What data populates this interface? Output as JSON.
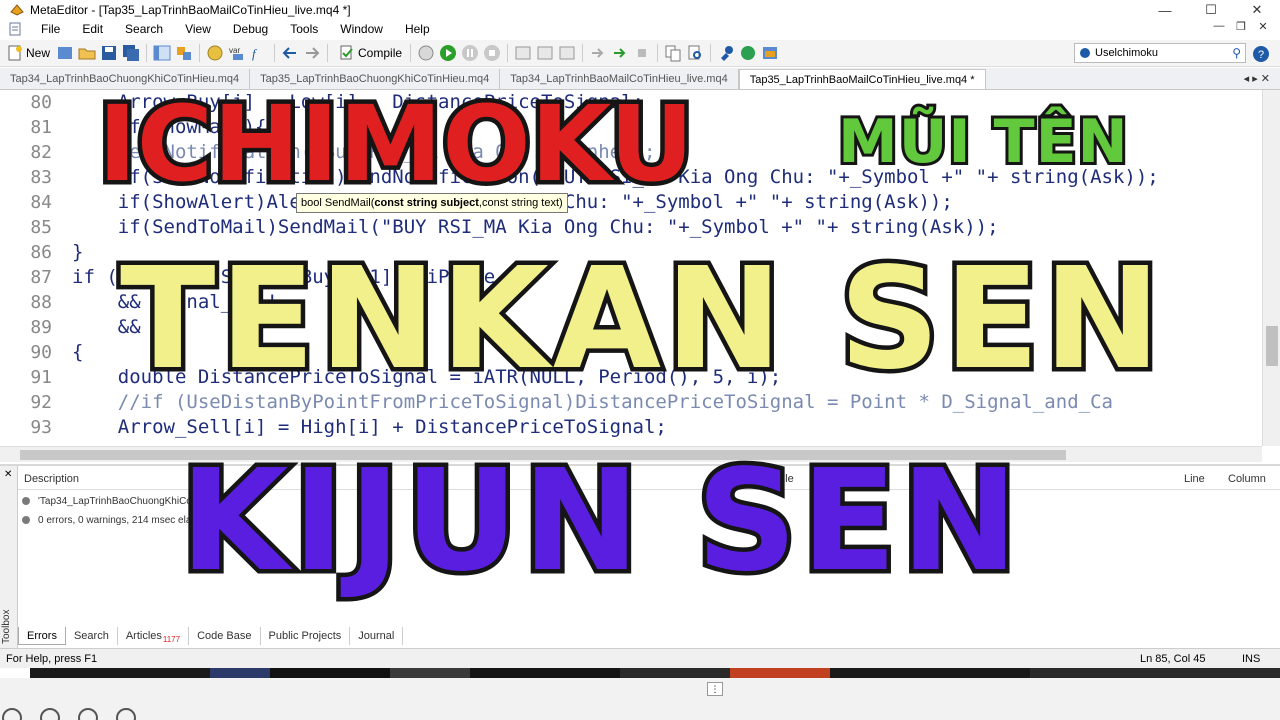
{
  "window": {
    "title": "MetaEditor - [Tap35_LapTrinhBaoMailCoTinHieu_live.mq4 *]",
    "controls": [
      "—",
      "☐",
      "✕"
    ]
  },
  "menu": {
    "items": [
      "File",
      "Edit",
      "Search",
      "View",
      "Debug",
      "Tools",
      "Window",
      "Help"
    ],
    "mdi_controls": [
      "—",
      "❐",
      "✕"
    ]
  },
  "toolbar": {
    "new_label": "New",
    "compile_label": "Compile",
    "search_value": "Uselchimoku"
  },
  "tabs": [
    {
      "label": "Tap34_LapTrinhBaoChuongKhiCoTinHieu.mq4",
      "active": false
    },
    {
      "label": "Tap35_LapTrinhBaoChuongKhiCoTinHieu.mq4",
      "active": false
    },
    {
      "label": "Tap34_LapTrinhBaoMailCoTinHieu_live.mq4",
      "active": false
    },
    {
      "label": "Tap35_LapTrinhBaoMailCoTinHieu_live.mq4 *",
      "active": true
    }
  ],
  "tab_controls": "◂ ▸ ✕",
  "editor": {
    "lines": [
      {
        "num": "80",
        "code": "    Arrow_Buy[i] = Low[i] - DistancePriceToSignal;"
      },
      {
        "num": "81",
        "code": "    if(ShowMail){"
      },
      {
        "num": "82",
        "code": "    SendNotification(\"Buy RSI_MA Kia Ong Chu nhe\");"
      },
      {
        "num": "83",
        "code": "    if(ShowNotification)SendNotification(\"BUY RSI_MA Kia Ong Chu: \"+_Symbol +\" \"+ string(Ask));"
      },
      {
        "num": "84",
        "code": "    if(ShowAlert)Alert(\"BUY RSI_MA Kia Ong Chu: \"+_Symbol +\" \"+ string(Ask));"
      },
      {
        "num": "85",
        "code": "    if(SendToMail)SendMail(\"BUY RSI_MA Kia Ong Chu: \"+_Symbol +\" \"+ string(Ask));"
      },
      {
        "num": "86",
        "code": "}"
      },
      {
        "num": "87",
        "code": "if (i > 0 && Signal_Buy[i-1] < iPrice"
      },
      {
        "num": "88",
        "code": "    && Signal_ok !"
      },
      {
        "num": "89",
        "code": "    && i"
      },
      {
        "num": "90",
        "code": "{"
      },
      {
        "num": "91",
        "code": "    double DistancePriceToSignal = iATR(NULL, Period(), 5, i);"
      },
      {
        "num": "92",
        "code": "    //if (UseDistanByPointFromPriceToSignal)DistancePriceToSignal = Point * D_Signal_and_Ca"
      },
      {
        "num": "93",
        "code": "    Arrow_Sell[i] = High[i] + DistancePriceToSignal;"
      }
    ],
    "tooltip": {
      "prefix": "bool SendMail(",
      "bold_part": "const string subject",
      "suffix": ",const string text)"
    }
  },
  "toolbox": {
    "side_label": "Toolbox",
    "close": "✕",
    "columns": {
      "description": "Description",
      "file": "File",
      "line": "Line",
      "column": "Column"
    },
    "rows": [
      "'Tap34_LapTrinhBaoChuongKhiCoTinHieu.mq4'",
      "0 errors, 0 warnings, 214 msec elapsed"
    ],
    "tabs": [
      {
        "label": "Errors",
        "active": true
      },
      {
        "label": "Search",
        "active": false
      },
      {
        "label": "Articles",
        "active": false,
        "count": "1177"
      },
      {
        "label": "Code Base",
        "active": false
      },
      {
        "label": "Public Projects",
        "active": false
      },
      {
        "label": "Journal",
        "active": false
      }
    ]
  },
  "status": {
    "help": "For Help, press F1",
    "position": "Ln 85, Col 45",
    "mode": "INS"
  },
  "overlay": {
    "title1": "ICHIMOKU",
    "title2": "MŨI TÊN",
    "title3": "TENKAN SEN",
    "title4": "KIJUN SEN"
  },
  "colors": {
    "ichimoku": "#e02020",
    "mui_ten": "#62c83c",
    "tenkan": "#f2f08a",
    "kijun": "#5a1ee0"
  }
}
